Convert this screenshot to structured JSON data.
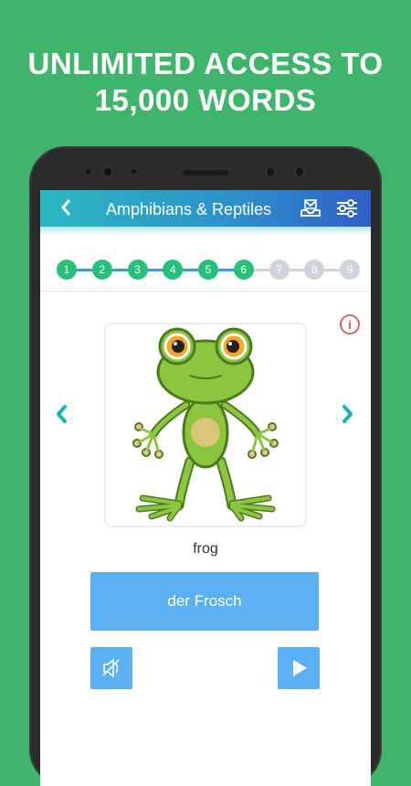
{
  "headline": {
    "line1": "UNLIMITED ACCESS TO",
    "line2": "15,000 WORDS"
  },
  "appbar": {
    "title": "Amphibians & Reptiles",
    "back_icon": "chevron-left-icon",
    "mail_icon": "inbox-tray-icon",
    "settings_icon": "sliders-icon"
  },
  "progress": {
    "steps": [
      "1",
      "2",
      "3",
      "4",
      "5",
      "6",
      "7",
      "8",
      "9"
    ],
    "completed": 6,
    "colors": {
      "done": "#25c07a",
      "todo": "#cfd3db",
      "line_done": "#3a9bdc",
      "line_todo": "#cfd3db"
    }
  },
  "card": {
    "image": "frog-illustration",
    "word": "frog",
    "translation": "der Frosch"
  },
  "controls": {
    "prev_icon": "chevron-left-icon",
    "next_icon": "chevron-right-icon",
    "info_icon": "info-icon",
    "info_glyph": "i",
    "sound_icon": "speaker-muted-icon",
    "play_icon": "play-icon"
  },
  "colors": {
    "background": "#3fb56b",
    "accent": "#5ab0f2",
    "teal": "#19b3c0"
  }
}
